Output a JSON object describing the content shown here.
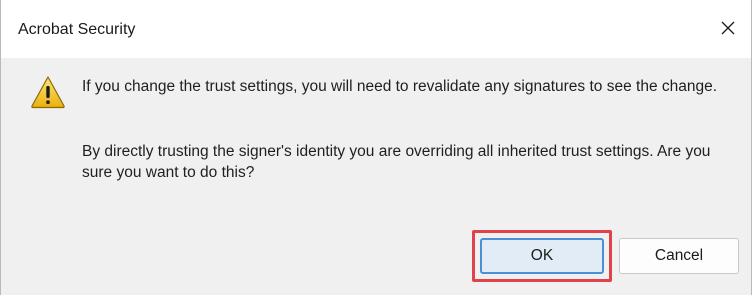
{
  "dialog": {
    "title": "Acrobat Security",
    "close_icon": "close-icon",
    "warning_icon": "warning-triangle-icon",
    "message_1": "If you change the trust settings, you will need to revalidate any signatures to see the change.",
    "message_2": "By directly trusting the signer's identity you are overriding all inherited trust settings. Are you sure you want to do this?",
    "buttons": {
      "ok_label": "OK",
      "cancel_label": "Cancel"
    },
    "colors": {
      "highlight": "#e0424a",
      "ok_border": "#4a90d6",
      "warning_yellow": "#f5c518"
    }
  }
}
